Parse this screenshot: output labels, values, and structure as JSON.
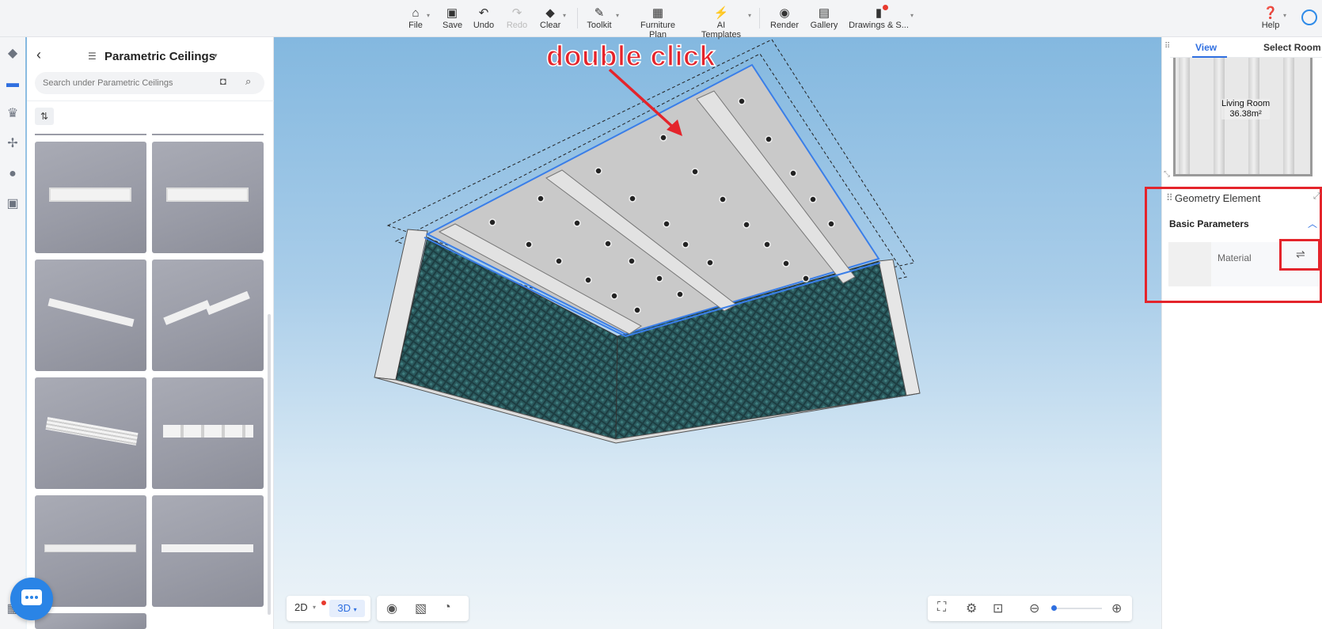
{
  "toolbar": {
    "items": [
      {
        "label": "File",
        "icon": "home-icon"
      },
      {
        "label": "Save",
        "icon": "save-icon"
      },
      {
        "label": "Undo",
        "icon": "undo-icon"
      },
      {
        "label": "Redo",
        "icon": "redo-icon"
      },
      {
        "label": "Clear",
        "icon": "eraser-icon"
      },
      {
        "label": "Toolkit",
        "icon": "wrench-icon"
      },
      {
        "label": "Furniture Plan",
        "icon": "layout-icon"
      },
      {
        "label": "AI Templates",
        "icon": "lightning-icon"
      },
      {
        "label": "Render",
        "icon": "camera-icon"
      },
      {
        "label": "Gallery",
        "icon": "gallery-icon"
      },
      {
        "label": "Drawings & S...",
        "icon": "document-icon"
      },
      {
        "label": "Help",
        "icon": "help-icon"
      }
    ]
  },
  "left_panel": {
    "title": "Parametric Ceilings",
    "search_placeholder": "Search under Parametric Ceilings"
  },
  "annotation": {
    "text": "double click",
    "color": "#e4242b"
  },
  "view_mode": {
    "option_2d": "2D",
    "option_3d": "3D",
    "selected": "3D"
  },
  "minimap": {
    "tab_view": "View",
    "tab_select_room": "Select Room",
    "room_name": "Living Room",
    "room_area": "36.38m²"
  },
  "properties": {
    "title": "Geometry Element",
    "section": "Basic Parameters",
    "material_label": "Material"
  },
  "colors": {
    "accent": "#2f6fe0",
    "highlight_red": "#e4242b",
    "selection_blue": "#3a7ee8"
  }
}
